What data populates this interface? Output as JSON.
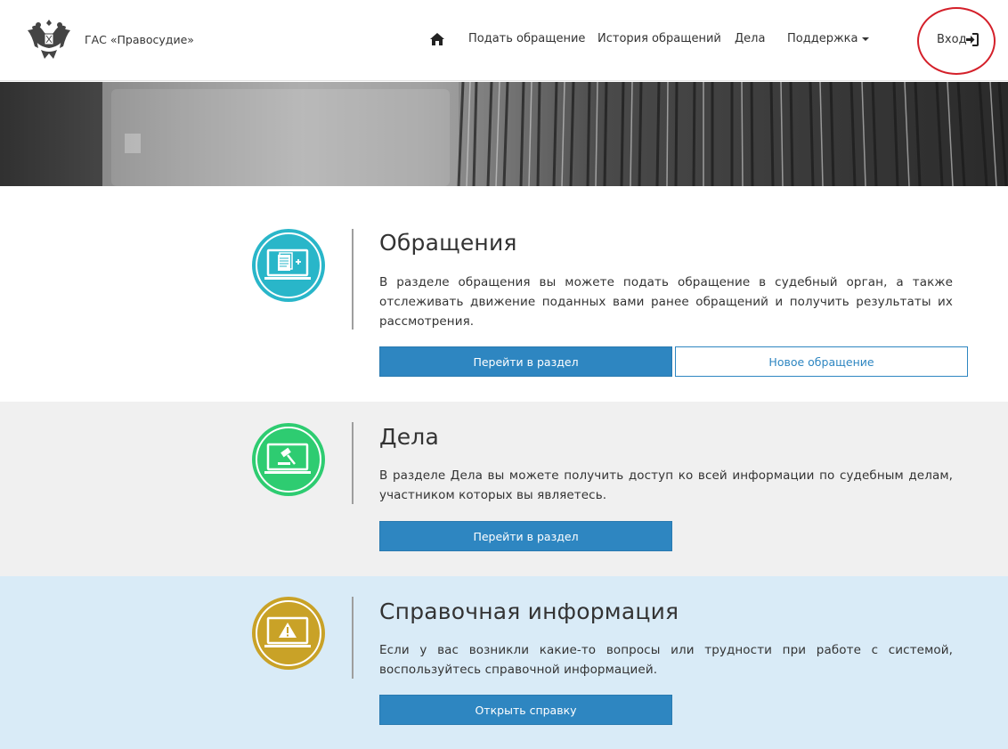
{
  "header": {
    "brand": "ГАС «Правосудие»",
    "nav": [
      {
        "label": "Подать обращение"
      },
      {
        "label": "История обращений"
      },
      {
        "label": "Дела"
      },
      {
        "label": "Поддержка"
      }
    ],
    "login_label": "Вход"
  },
  "sections": [
    {
      "title": "Обращения",
      "text": "В разделе обращения вы можете подать обращение в судебный орган, а также отслеживать движение поданных вами ранее обращений и получить результаты их рассмотрения.",
      "primary_button": "Перейти в раздел",
      "secondary_button": "Новое обращение",
      "icon_color": "#29b6c9"
    },
    {
      "title": "Дела",
      "text": "В разделе Дела вы можете получить доступ ко всей информации по судебным делам, участником которых вы являетесь.",
      "primary_button": "Перейти в раздел",
      "icon_color": "#2ecc71"
    },
    {
      "title": "Справочная информация",
      "text": "Если у вас возникли какие-то вопросы или трудности при работе с системой, воспользуйтесь справочной информацией.",
      "primary_button": "Открыть справку",
      "icon_color": "#c9a227"
    }
  ],
  "icons": {
    "logo": "coat-of-arms-logo",
    "home": "home-icon",
    "login": "sign-in-icon",
    "dropdown": "caret-down-icon",
    "section1": "document-laptop-icon",
    "section2": "gavel-laptop-icon",
    "section3": "warning-laptop-icon"
  },
  "colors": {
    "primary": "#2e86c1",
    "highlight": "#d4202a",
    "section2_bg": "#f0f0f0",
    "section3_bg": "#d9ebf7"
  }
}
